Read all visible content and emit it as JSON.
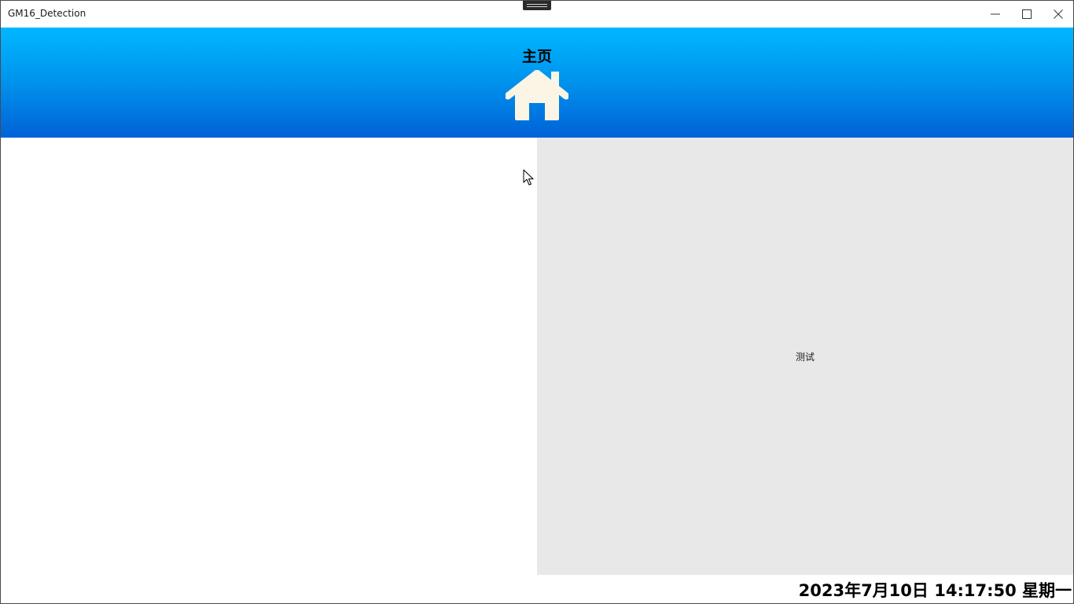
{
  "window": {
    "title": "GM16_Detection",
    "controls": {
      "minimize_icon": "minimize-icon",
      "maximize_icon": "maximize-icon",
      "close_icon": "close-icon"
    }
  },
  "header": {
    "nav_label": "主页",
    "nav_icon": "home-icon",
    "gradient_top": "#00b8ff",
    "gradient_bottom": "#0062d8",
    "icon_color": "#fbf5e6"
  },
  "main": {
    "right_panel_text": "测试",
    "right_panel_bg": "#e8e8e8"
  },
  "status": {
    "datetime": "2023年7月10日 14:17:50 星期一"
  }
}
